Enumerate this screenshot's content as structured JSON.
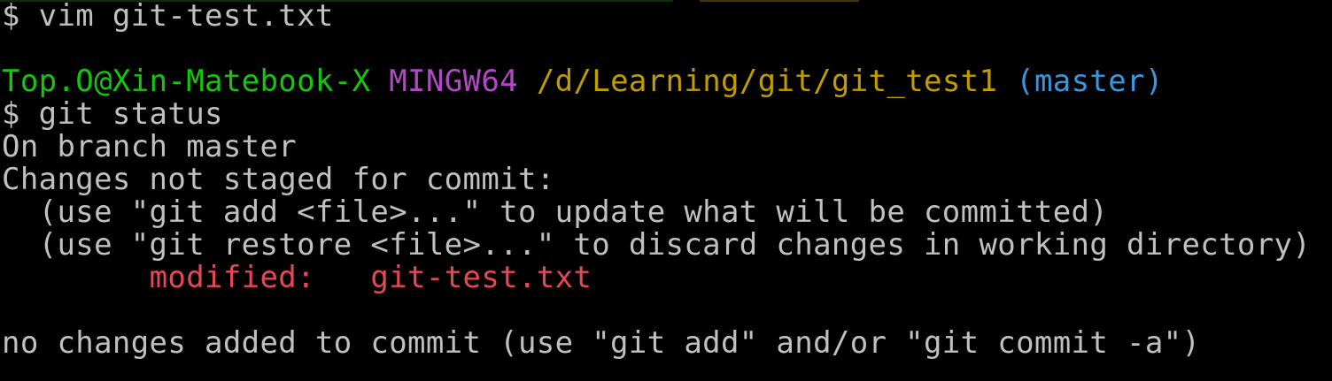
{
  "terminal": {
    "colors": {
      "background": "#000000",
      "text": "#c0c0c0",
      "user": "#16c60c",
      "msystem": "#b148c6",
      "path": "#c19c00",
      "branch": "#3a96dd",
      "modified": "#e74856"
    },
    "line1": {
      "prompt": "$ ",
      "command": "vim git-test.txt"
    },
    "prompt_header": {
      "user_host": "Top.O@Xin-Matebook-X",
      "msystem": "MINGW64",
      "path": "/d/Learning/git/git_test1",
      "branch": "(master)"
    },
    "line2": {
      "prompt": "$ ",
      "command": "git status"
    },
    "output": {
      "branch_line": "On branch master",
      "changes_header": "Changes not staged for commit:",
      "hint1": "  (use \"git add <file>...\" to update what will be committed)",
      "hint2": "  (use \"git restore <file>...\" to discard changes in working directory)",
      "modified_label": "modified:",
      "modified_file": "git-test.txt",
      "footer": "no changes added to commit (use \"git add\" and/or \"git commit -a\")"
    }
  }
}
